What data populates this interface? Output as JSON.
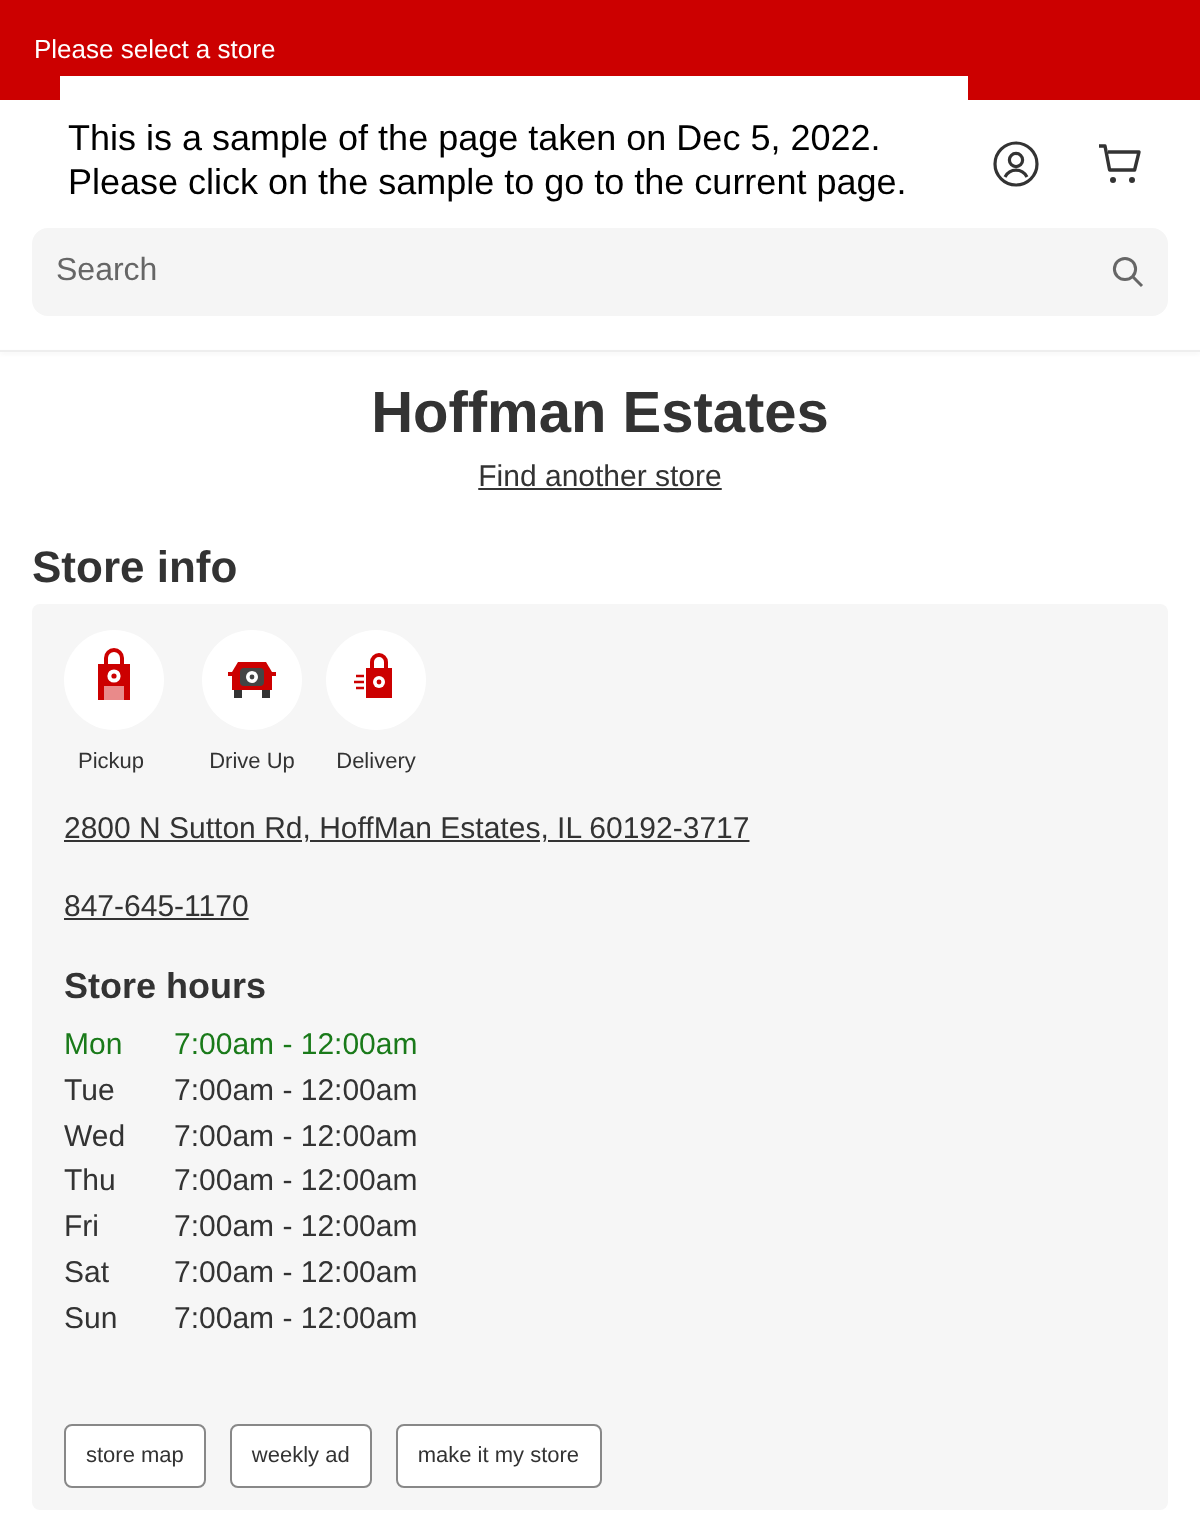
{
  "top_bar": {
    "store_prompt": "Please select a store"
  },
  "sample_notice": {
    "lines": [
      "This is a sample of the page taken on Dec 5, 2022.",
      "Please click on the sample to go to the current page."
    ]
  },
  "search": {
    "placeholder": "Search"
  },
  "store": {
    "name": "Hoffman Estates",
    "find_link": "Find another store"
  },
  "store_info": {
    "heading": "Store info",
    "services": [
      {
        "kind": "pickup",
        "label": "Pickup"
      },
      {
        "kind": "driveup",
        "label": "Drive Up"
      },
      {
        "kind": "delivery",
        "label": "Delivery"
      }
    ],
    "address": "2800 N Sutton Rd, HoffMan Estates, IL 60192-3717",
    "phone": "847-645-1170",
    "hours_heading": "Store hours",
    "hours": [
      {
        "day": "Mon",
        "time": "7:00am - 12:00am",
        "today": true
      },
      {
        "day": "Tue",
        "time": "7:00am - 12:00am",
        "today": false
      },
      {
        "day": "Wed",
        "time": "7:00am - 12:00am",
        "today": false
      },
      {
        "day": "Thu",
        "time": "7:00am - 12:00am",
        "today": false
      },
      {
        "day": "Fri",
        "time": "7:00am - 12:00am",
        "today": false
      },
      {
        "day": "Sat",
        "time": "7:00am - 12:00am",
        "today": false
      },
      {
        "day": "Sun",
        "time": "7:00am - 12:00am",
        "today": false
      }
    ],
    "buttons": [
      "store map",
      "weekly ad",
      "make it my store"
    ]
  }
}
